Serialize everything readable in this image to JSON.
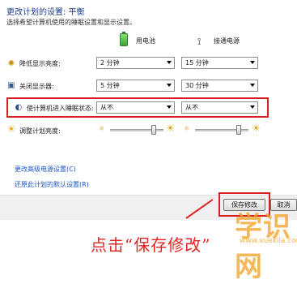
{
  "title": "更改计划的设置: 平衡",
  "subtitle": "选择希望计算机使用的睡眠设置和显示设置。",
  "columns": {
    "battery_label": "用电池",
    "power_label": "接通电源"
  },
  "rows": {
    "dim": {
      "label": "降低显示亮度:",
      "battery_value": "2 分钟",
      "power_value": "15 分钟"
    },
    "off": {
      "label": "关闭显示器:",
      "battery_value": "5 分钟",
      "power_value": "30 分钟"
    },
    "sleep": {
      "label": "使计算机进入睡眠状态:",
      "battery_value": "从不",
      "power_value": "从不"
    },
    "brightness": {
      "label": "调整计划亮度:",
      "battery_level": 0.85,
      "power_level": 0.85
    }
  },
  "links": {
    "advanced": "更改高级电源设置(C)",
    "restore": "还原此计划的默认设置(R)"
  },
  "buttons": {
    "save": "保存修改",
    "cancel": "取消"
  },
  "caption": "点击“保存修改”",
  "watermark": {
    "main": "学识网",
    "sub": "www.xuexila.com"
  },
  "colors": {
    "highlight": "#d81e1e",
    "link": "#1a56c8",
    "caption": "#e42424"
  }
}
